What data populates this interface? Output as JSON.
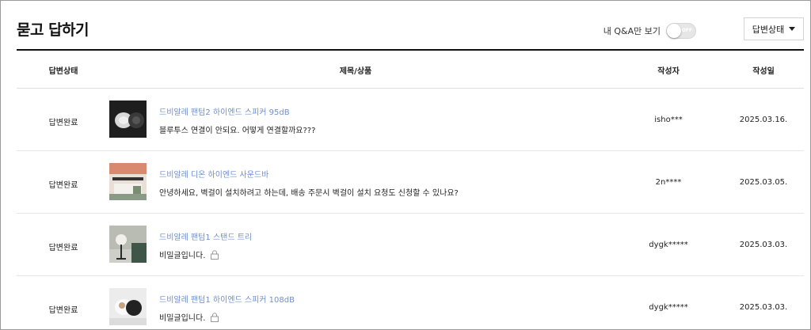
{
  "header": {
    "title": "묻고 답하기",
    "my_qa_label": "내 Q&A만 보기",
    "toggle_state": "OFF",
    "status_filter_label": "답변상태",
    "status_filter_icon": "caret-down-icon"
  },
  "table": {
    "columns": [
      "답변상태",
      "제목/상품",
      "작성자",
      "작성일"
    ],
    "rows": [
      {
        "status": "답변완료",
        "product": "드비알레 팬텀2 하이엔드 스피커 95dB",
        "question": "블루투스 연결이 안되요. 어떻게 연결할까요???",
        "secret": false,
        "author": "isho***",
        "date": "2025.03.16."
      },
      {
        "status": "답변완료",
        "product": "드비알레 디온 하이엔드 사운드바",
        "question": "안녕하세요, 벽걸이 설치하려고 하는데, 배송 주문시 벽걸이 설치 요청도 신청할 수 있나요?",
        "secret": false,
        "author": "2n****",
        "date": "2025.03.05."
      },
      {
        "status": "답변완료",
        "product": "드비알레 팬텀1 스탠드 트리",
        "question": "비밀글입니다.",
        "secret": true,
        "author": "dygk*****",
        "date": "2025.03.03."
      },
      {
        "status": "답변완료",
        "product": "드비알레 팬텀1 하이엔드 스피커 108dB",
        "question": "비밀글입니다.",
        "secret": true,
        "author": "dygk*****",
        "date": "2025.03.03."
      }
    ]
  },
  "colors": {
    "product_link": "#6f8fcf",
    "title_rule": "#111111",
    "toggle_off": "#e6e6e6"
  }
}
